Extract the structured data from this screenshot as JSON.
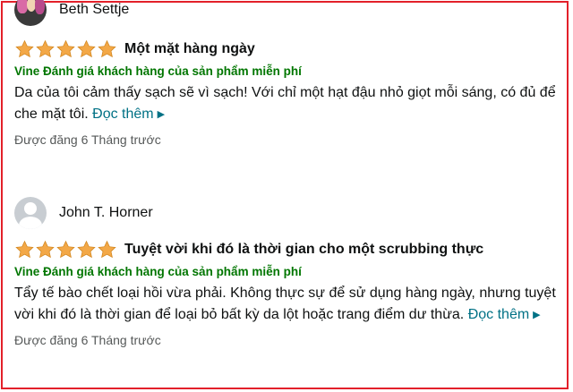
{
  "colors": {
    "star": "#f3a847",
    "vine": "#007600",
    "link": "#007185",
    "border": "#e3202a",
    "muted": "#565959"
  },
  "reviews": [
    {
      "author": "Beth Settje",
      "avatar": "photo",
      "rating": 5,
      "title": "Một mặt hàng ngày",
      "vine_label": "Vine Đánh giá khách hàng của sản phẩm miễn phí",
      "body": "Da của tôi cảm thấy sạch sẽ vì sạch! Với chỉ một hạt đậu nhỏ giọt mỗi sáng, có đủ để che mặt tôi.",
      "read_more": "Đọc thêm",
      "date": "Được đăng 6 Tháng trước"
    },
    {
      "author": "John T. Horner",
      "avatar": "generic-user-icon",
      "rating": 5,
      "title": "Tuyệt vời khi đó là thời gian cho một scrubbing thực",
      "vine_label": "Vine Đánh giá khách hàng của sản phẩm miễn phí",
      "body": "Tẩy tế bào chết loại hồi vừa phải. Không thực sự để sử dụng hàng ngày, nhưng tuyệt vời khi đó là thời gian để loại bỏ bất kỳ da lột hoặc trang điểm dư thừa.",
      "read_more": "Đọc thêm",
      "date": "Được đăng 6 Tháng trước"
    }
  ]
}
